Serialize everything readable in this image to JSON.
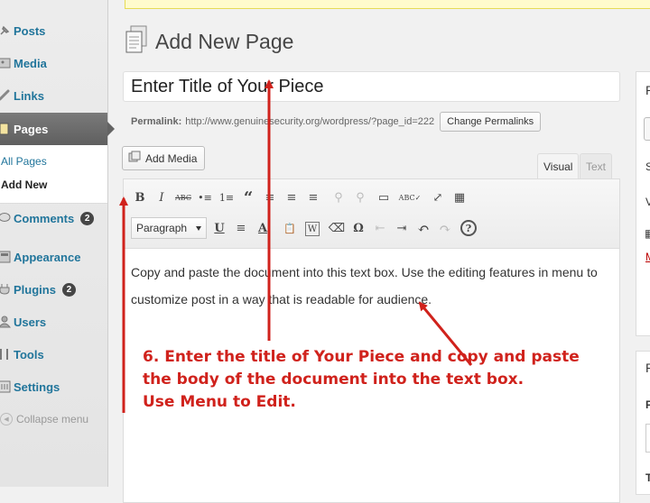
{
  "sidebar": {
    "items": [
      {
        "label": "Posts",
        "icon": "pushpin-icon"
      },
      {
        "label": "Media",
        "icon": "media-icon"
      },
      {
        "label": "Links",
        "icon": "link-icon"
      },
      {
        "label": "Pages",
        "icon": "pages-icon",
        "current": true
      },
      {
        "label": "Comments",
        "icon": "comment-icon",
        "badge": "2"
      },
      {
        "label": "Appearance",
        "icon": "appearance-icon"
      },
      {
        "label": "Plugins",
        "icon": "plugin-icon",
        "badge": "2"
      },
      {
        "label": "Users",
        "icon": "users-icon"
      },
      {
        "label": "Tools",
        "icon": "tools-icon"
      },
      {
        "label": "Settings",
        "icon": "settings-icon"
      }
    ],
    "submenu": [
      "All Pages",
      "Add New"
    ],
    "collapse_label": "Collapse menu"
  },
  "heading": {
    "title": "Add New Page"
  },
  "title_input": {
    "value": "Enter Title of Your Piece"
  },
  "permalink": {
    "label": "Permalink:",
    "url": "http://www.genuinesecurity.org/wordpress/?page_id=222",
    "button": "Change Permalinks"
  },
  "add_media": {
    "label": "Add Media"
  },
  "editor": {
    "tabs": {
      "visual": "Visual",
      "text": "Text"
    },
    "format": "Paragraph",
    "body": "Copy and paste the document into this text box.  Use the editing features in menu to customize post in a way that is readable for audience.",
    "toolbar_row1": [
      "B",
      "I",
      "ABC",
      "•≡",
      "1≡",
      "“",
      "≡",
      "≡",
      "≡",
      "⚲",
      "⚲",
      "▭",
      "ABC✓",
      "⤢",
      "▦"
    ],
    "toolbar_row2": [
      "U",
      "≡",
      "A",
      "📋",
      "W",
      "⌫",
      "Ω",
      "⇤",
      "⇥",
      "↶",
      "↷",
      "?"
    ]
  },
  "annotation": {
    "lines": [
      "6. Enter the title of Your Piece and copy and paste",
      "the body of the document into the text box.",
      "Use Menu to Edit."
    ]
  },
  "colors": {
    "annotation": "#d0221c",
    "link": "#21759b",
    "current_menu": "#6a6a6a"
  }
}
